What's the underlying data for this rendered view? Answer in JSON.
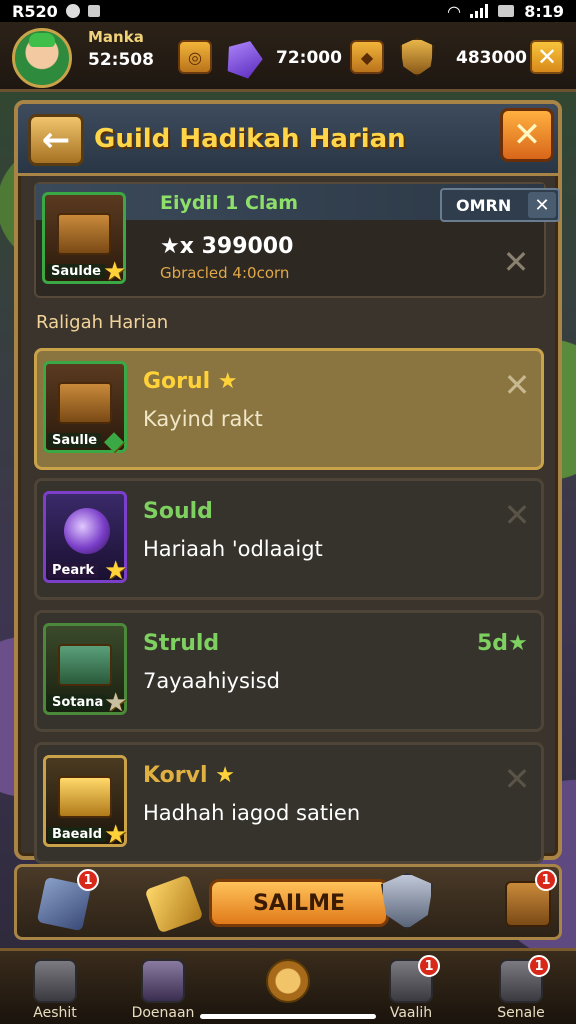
{
  "status_bar": {
    "left_text": "R520",
    "time": "8:19"
  },
  "player": {
    "name": "Manka",
    "level": "52:508"
  },
  "resources": {
    "gems": "72:000",
    "gold": "483000"
  },
  "header": {
    "title": "Guild Hadikah Harian"
  },
  "featured": {
    "name": "Eiydil 1 Clam",
    "amount": "★x 399000",
    "sub": "Gbracled 4:0corn",
    "icon_label": "Saulde",
    "claim_label": "OMRN"
  },
  "section_title": "Raligah Harian",
  "cards": [
    {
      "name": "Gorul",
      "desc": "Kayind rakt",
      "icon_label": "Saulle",
      "badge": ""
    },
    {
      "name": "Sould",
      "desc": "Hariaah 'odlaaigt",
      "icon_label": "Peark",
      "badge": ""
    },
    {
      "name": "Struld",
      "desc": "7ayaahiysisd",
      "icon_label": "Sotana",
      "badge": "5d★"
    },
    {
      "name": "Korvl",
      "desc": "Hadhah iagod satien",
      "icon_label": "Baeald",
      "badge": ""
    }
  ],
  "action": {
    "main_label": "SAILME",
    "badge_1": "1",
    "badge_2": "1"
  },
  "nav": [
    {
      "label": "Aeshit"
    },
    {
      "label": "Doenaan"
    },
    {
      "label": ""
    },
    {
      "label": "Vaalih"
    },
    {
      "label": "Senale"
    }
  ],
  "nav_badges": {
    "item4": "1",
    "item5": "1"
  }
}
